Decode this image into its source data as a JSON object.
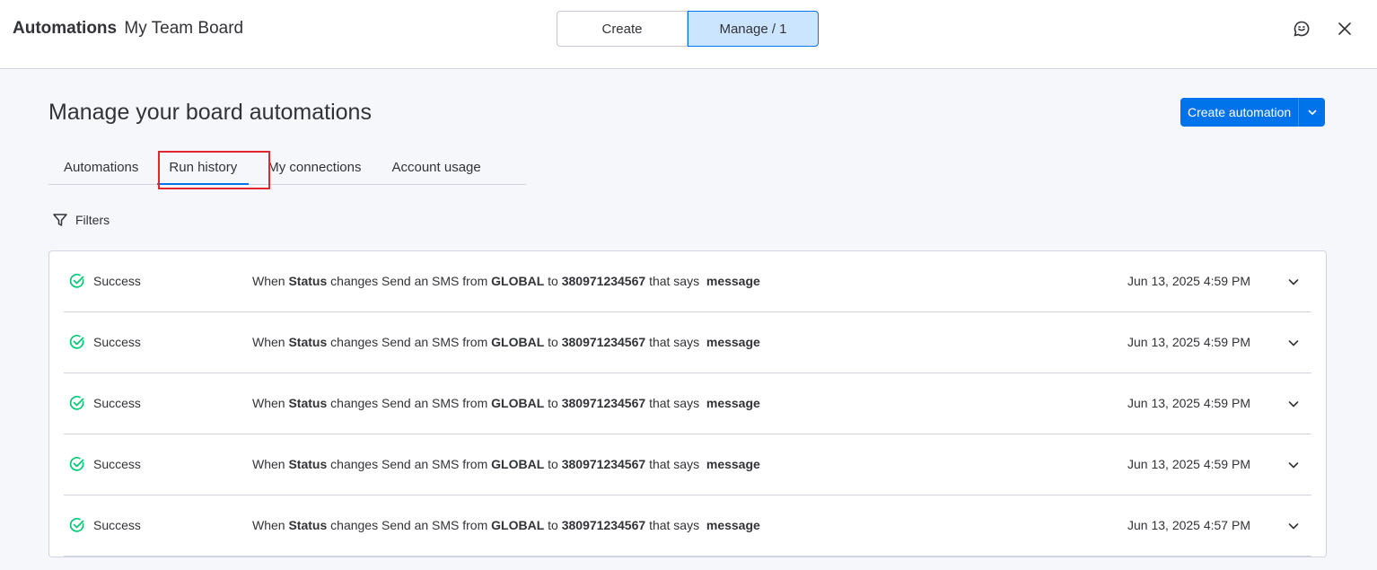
{
  "header": {
    "title_bold": "Automations",
    "title_rest": "My Team Board",
    "segment": {
      "create_label": "Create",
      "manage_label": "Manage / 1"
    }
  },
  "page": {
    "title": "Manage your board automations",
    "create_button_label": "Create automation"
  },
  "tabs": [
    {
      "label": "Automations"
    },
    {
      "label": "Run history"
    },
    {
      "label": "My connections"
    },
    {
      "label": "Account usage"
    }
  ],
  "filters_label": "Filters",
  "runs": [
    {
      "status": "Success",
      "w1": "When",
      "b1": "Status",
      "w2": "changes Send an SMS from",
      "b2": "GLOBAL",
      "w3": "to",
      "b3": "380971234567",
      "w4": "that says",
      "b4": "message",
      "date": "Jun 13, 2025 4:59 PM"
    },
    {
      "status": "Success",
      "w1": "When",
      "b1": "Status",
      "w2": "changes Send an SMS from",
      "b2": "GLOBAL",
      "w3": "to",
      "b3": "380971234567",
      "w4": "that says",
      "b4": "message",
      "date": "Jun 13, 2025 4:59 PM"
    },
    {
      "status": "Success",
      "w1": "When",
      "b1": "Status",
      "w2": "changes Send an SMS from",
      "b2": "GLOBAL",
      "w3": "to",
      "b3": "380971234567",
      "w4": "that says",
      "b4": "message",
      "date": "Jun 13, 2025 4:59 PM"
    },
    {
      "status": "Success",
      "w1": "When",
      "b1": "Status",
      "w2": "changes Send an SMS from",
      "b2": "GLOBAL",
      "w3": "to",
      "b3": "380971234567",
      "w4": "that says",
      "b4": "message",
      "date": "Jun 13, 2025 4:59 PM"
    },
    {
      "status": "Success",
      "w1": "When",
      "b1": "Status",
      "w2": "changes Send an SMS from",
      "b2": "GLOBAL",
      "w3": "to",
      "b3": "380971234567",
      "w4": "that says",
      "b4": "message",
      "date": "Jun 13, 2025 4:57 PM"
    }
  ],
  "colors": {
    "accent": "#0073ea",
    "success": "#00c875",
    "highlight": "#e2272f"
  },
  "icons": [
    "feedback-icon",
    "close-icon",
    "chevron-down-icon",
    "filter-icon",
    "success-check-icon"
  ]
}
